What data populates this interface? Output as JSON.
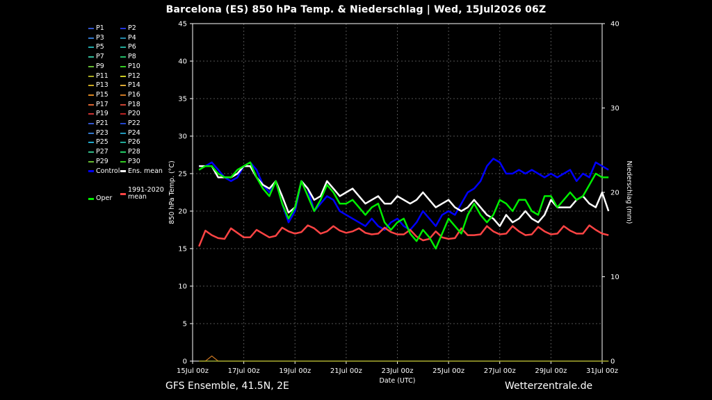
{
  "title": "Barcelona  (ES)  850 hPa Temp. & Niederschlag | Wed, 15Jul2026 06Z",
  "footer": {
    "left": "GFS Ensemble, 41.5N, 2E",
    "right": "Wetterzentrale.de"
  },
  "legend": {
    "members": [
      {
        "label": "P1",
        "color": "#3355cc"
      },
      {
        "label": "P2",
        "color": "#2233dd"
      },
      {
        "label": "P3",
        "color": "#3377cc"
      },
      {
        "label": "P4",
        "color": "#2288aa"
      },
      {
        "label": "P5",
        "color": "#22aaaa"
      },
      {
        "label": "P6",
        "color": "#22aa99"
      },
      {
        "label": "P7",
        "color": "#33bb99"
      },
      {
        "label": "P8",
        "color": "#22bb66"
      },
      {
        "label": "P9",
        "color": "#66bb33"
      },
      {
        "label": "P10",
        "color": "#33cc22"
      },
      {
        "label": "P11",
        "color": "#aaaa22"
      },
      {
        "label": "P12",
        "color": "#cccc22"
      },
      {
        "label": "P13",
        "color": "#ccaa22"
      },
      {
        "label": "P14",
        "color": "#ddaa33"
      },
      {
        "label": "P15",
        "color": "#dd8822"
      },
      {
        "label": "P16",
        "color": "#cc7722"
      },
      {
        "label": "P17",
        "color": "#dd6633"
      },
      {
        "label": "P18",
        "color": "#cc4433"
      },
      {
        "label": "P19",
        "color": "#cc3333"
      },
      {
        "label": "P20",
        "color": "#bb2222"
      },
      {
        "label": "P21",
        "color": "#3355cc"
      },
      {
        "label": "P22",
        "color": "#2244cc"
      },
      {
        "label": "P23",
        "color": "#3377cc"
      },
      {
        "label": "P24",
        "color": "#2299bb"
      },
      {
        "label": "P25",
        "color": "#22aacc"
      },
      {
        "label": "P26",
        "color": "#22aa99"
      },
      {
        "label": "P27",
        "color": "#33bb88"
      },
      {
        "label": "P28",
        "color": "#22cc66"
      },
      {
        "label": "P29",
        "color": "#66bb33"
      },
      {
        "label": "P30",
        "color": "#33cc22"
      }
    ],
    "control_label": "Control",
    "ens_mean_label": "Ens. mean",
    "climate_label": "1991-2020\nmean",
    "oper_label": "Oper",
    "control_color": "#0000ff",
    "ens_mean_color": "#ffffff",
    "climate_color": "#ff4444",
    "oper_color": "#00ee00"
  },
  "chart_data": {
    "type": "line",
    "xlabel": "Date (UTC)",
    "ylabel": "850 hPa Temp. (°C)",
    "y2label": "Niederschlag (mm)",
    "ylim": [
      0,
      45
    ],
    "y2lim": [
      0,
      40
    ],
    "yticks": [
      0,
      5,
      10,
      15,
      20,
      25,
      30,
      35,
      40,
      45
    ],
    "y2ticks": [
      0,
      10,
      20,
      30,
      40
    ],
    "xticks": [
      "15Jul 00z",
      "17Jul 00z",
      "19Jul 00z",
      "21Jul 00z",
      "23Jul 00z",
      "25Jul 00z",
      "27Jul 00z",
      "29Jul 00z",
      "31Jul 00z"
    ],
    "x_days": [
      0,
      16
    ],
    "grid": true,
    "series": [
      {
        "name": "Control",
        "color": "#0000ff",
        "width": 2.5,
        "t0": 0.25,
        "step": 0.25,
        "values": [
          26.0,
          26.0,
          26.5,
          25.5,
          24.5,
          24.0,
          24.5,
          26.0,
          26.5,
          25.5,
          23.5,
          22.5,
          24.0,
          21.0,
          18.5,
          20.0,
          24.0,
          23.0,
          20.0,
          21.0,
          22.0,
          21.5,
          20.0,
          19.5,
          19.0,
          18.5,
          18.0,
          19.0,
          18.0,
          17.5,
          18.5,
          19.0,
          18.0,
          17.5,
          18.5,
          20.0,
          19.0,
          18.0,
          19.5,
          20.0,
          19.5,
          21.0,
          22.5,
          23.0,
          24.0,
          26.0,
          27.0,
          26.5,
          25.0,
          25.0,
          25.5,
          25.0,
          25.5,
          25.0,
          24.5,
          25.0,
          24.5,
          25.0,
          25.5,
          24.0,
          25.0,
          24.5,
          26.5,
          26.0,
          25.5
        ]
      },
      {
        "name": "Ens. mean",
        "color": "#ffffff",
        "width": 2.5,
        "t0": 0.25,
        "step": 0.25,
        "values": [
          26.0,
          26.0,
          26.0,
          24.5,
          24.5,
          24.5,
          25.0,
          26.0,
          26.0,
          24.5,
          23.5,
          23.0,
          24.0,
          22.0,
          19.8,
          20.5,
          24.0,
          23.0,
          21.5,
          22.0,
          24.0,
          23.0,
          22.0,
          22.5,
          23.0,
          22.0,
          21.0,
          21.5,
          22.0,
          21.0,
          21.0,
          22.0,
          21.5,
          21.0,
          21.5,
          22.5,
          21.5,
          20.5,
          21.0,
          21.5,
          20.5,
          20.0,
          20.5,
          21.5,
          20.5,
          19.5,
          19.0,
          18.0,
          19.5,
          18.5,
          19.0,
          20.0,
          19.0,
          18.5,
          19.5,
          21.5,
          20.5,
          20.5,
          20.5,
          21.5,
          22.0,
          21.0,
          20.5,
          22.5,
          20.0
        ]
      },
      {
        "name": "1991-2020 mean",
        "color": "#ff4444",
        "width": 2.5,
        "t0": 0.25,
        "step": 0.25,
        "values": [
          15.3,
          17.4,
          16.8,
          16.4,
          16.3,
          17.7,
          17.1,
          16.5,
          16.5,
          17.5,
          17.0,
          16.5,
          16.7,
          17.8,
          17.3,
          17.0,
          17.2,
          18.1,
          17.7,
          17.0,
          17.3,
          18.0,
          17.4,
          17.1,
          17.3,
          17.7,
          17.1,
          16.9,
          17.0,
          17.8,
          17.2,
          16.9,
          16.9,
          17.5,
          16.6,
          16.1,
          16.3,
          17.3,
          16.5,
          16.3,
          16.4,
          17.7,
          16.8,
          16.8,
          16.9,
          18.0,
          17.3,
          16.9,
          17.0,
          18.0,
          17.3,
          16.8,
          16.9,
          17.9,
          17.3,
          16.9,
          17.0,
          18.0,
          17.4,
          17.0,
          17.0,
          18.1,
          17.5,
          17.0,
          16.8
        ]
      },
      {
        "name": "Oper",
        "color": "#00ee00",
        "width": 2.5,
        "t0": 0.25,
        "step": 0.25,
        "values": [
          25.5,
          26.0,
          26.0,
          25.0,
          24.5,
          24.5,
          25.5,
          26.0,
          26.5,
          24.5,
          23.0,
          22.0,
          24.0,
          21.0,
          19.0,
          20.5,
          24.0,
          22.0,
          20.0,
          21.5,
          23.5,
          22.5,
          21.0,
          21.0,
          21.5,
          20.5,
          19.5,
          20.5,
          21.0,
          18.5,
          17.5,
          18.5,
          19.0,
          17.0,
          16.0,
          17.5,
          16.5,
          15.0,
          17.0,
          19.0,
          18.0,
          17.0,
          19.5,
          21.0,
          19.5,
          18.5,
          19.5,
          21.5,
          21.0,
          20.0,
          21.5,
          21.5,
          20.0,
          19.5,
          22.0,
          22.0,
          20.5,
          21.5,
          22.5,
          21.5,
          22.0,
          23.5,
          25.0,
          24.5,
          24.5
        ]
      }
    ],
    "precip_series": [
      {
        "name": "P5",
        "color": "#22aaaa",
        "t0": 0.25,
        "step": 0.25,
        "values": [
          0,
          0,
          0,
          0,
          0,
          0,
          0,
          0,
          0,
          0,
          0,
          0,
          0,
          0,
          0,
          0,
          0,
          0,
          0,
          0,
          0,
          0,
          0,
          0,
          0,
          0,
          0,
          0,
          0,
          0,
          0,
          0,
          0,
          0,
          0,
          0,
          0,
          0,
          0,
          0,
          0,
          0,
          0,
          0,
          0,
          0,
          0,
          0,
          0,
          0,
          0,
          0,
          0,
          0,
          0,
          0,
          0,
          0,
          0,
          0,
          0,
          0,
          0,
          0,
          0
        ]
      },
      {
        "name": "P16",
        "color": "#cc7722",
        "t0": 0.25,
        "step": 0.25,
        "values": [
          0,
          0,
          0.6,
          0,
          0,
          0,
          0,
          0,
          0,
          0,
          0,
          0,
          0,
          0,
          0,
          0,
          0,
          0,
          0,
          0,
          0,
          0,
          0,
          0,
          0,
          0,
          0,
          0,
          0,
          0,
          0,
          0,
          0,
          0,
          0,
          0,
          0,
          0,
          0,
          0,
          0,
          0,
          0,
          0,
          0,
          0,
          0,
          0,
          0,
          0,
          0,
          0,
          0,
          0,
          0,
          0,
          0,
          0,
          0,
          0,
          0,
          0,
          0,
          0,
          0
        ]
      },
      {
        "name": "P11",
        "color": "#aaaa22",
        "t0": 0.25,
        "step": 0.25,
        "values": [
          0,
          0,
          0,
          0,
          0,
          0,
          0,
          0,
          0,
          0,
          0,
          0,
          0,
          0,
          0,
          0,
          0,
          0,
          0,
          0,
          0,
          0,
          0,
          0,
          0,
          0,
          0,
          0,
          0,
          0,
          0,
          0,
          0,
          0,
          0,
          0,
          0,
          0,
          0,
          0,
          0,
          0,
          0,
          0,
          0,
          0,
          0,
          0,
          0,
          0,
          0,
          0,
          0,
          0,
          0,
          0,
          0,
          0,
          0,
          0,
          0,
          0,
          0,
          0,
          0
        ]
      }
    ]
  }
}
